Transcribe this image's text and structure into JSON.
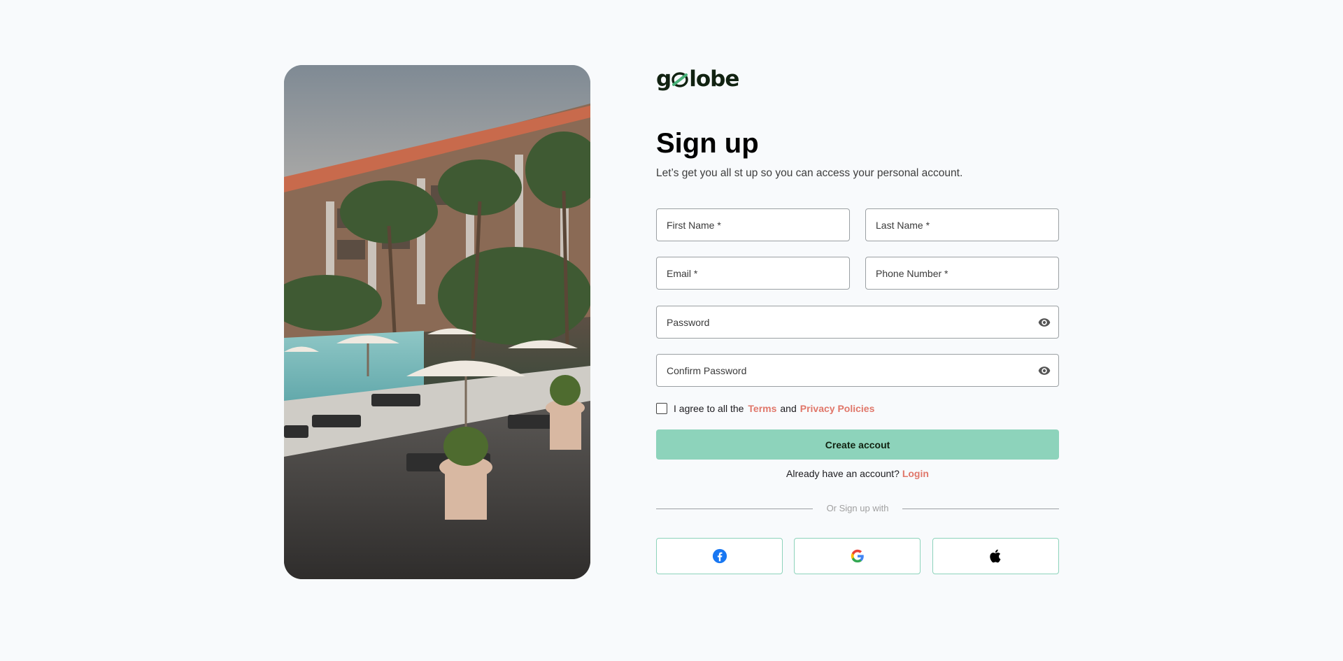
{
  "brand": {
    "logo_text_left": "g",
    "logo_text_right": "lobe",
    "accent": "#8dd3bb",
    "link_color": "#e0776a"
  },
  "heading": {
    "title": "Sign up",
    "subtitle": "Let’s get you all st up so you can access your personal account."
  },
  "fields": {
    "first_name": {
      "placeholder": "First Name *",
      "value": ""
    },
    "last_name": {
      "placeholder": "Last Name *",
      "value": ""
    },
    "email": {
      "placeholder": "Email *",
      "value": ""
    },
    "phone": {
      "placeholder": "Phone Number *",
      "value": ""
    },
    "password": {
      "placeholder": "Password",
      "value": "",
      "icon": "eye-icon"
    },
    "confirm_password": {
      "placeholder": "Confirm Password",
      "value": "",
      "icon": "eye-icon"
    }
  },
  "agreement": {
    "prefix": "I agree to all the",
    "terms": "Terms",
    "and": "and",
    "privacy": "Privacy Policies",
    "checked": false
  },
  "actions": {
    "create_label": "Create accout",
    "already_text": "Already have an account?",
    "login_label": "Login"
  },
  "divider_text": "Or Sign up with",
  "social": [
    {
      "name": "facebook",
      "icon": "facebook-icon",
      "color": "#1877f2"
    },
    {
      "name": "google",
      "icon": "google-icon"
    },
    {
      "name": "apple",
      "icon": "apple-icon",
      "color": "#000000"
    }
  ]
}
